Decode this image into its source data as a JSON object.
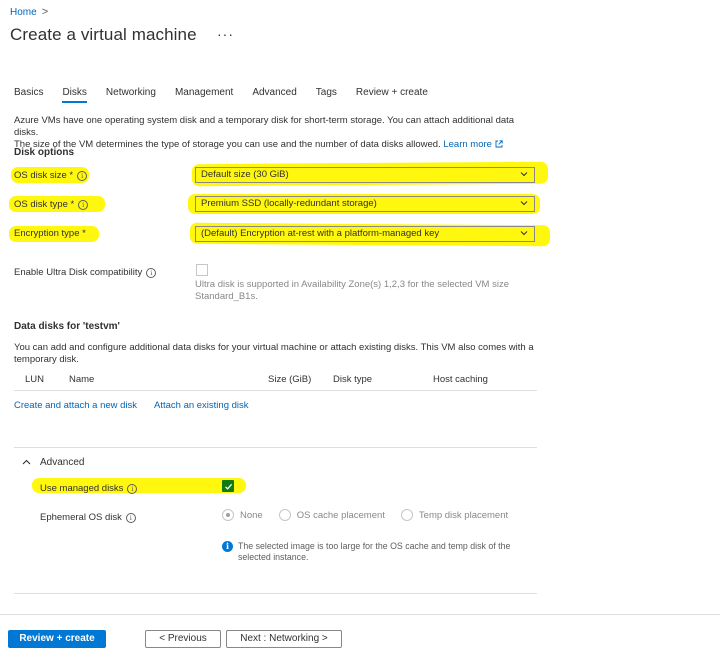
{
  "breadcrumb": {
    "home": "Home",
    "separator": ">"
  },
  "page": {
    "title": "Create a virtual machine",
    "more": "···"
  },
  "tabs": [
    {
      "label": "Basics"
    },
    {
      "label": "Disks"
    },
    {
      "label": "Networking"
    },
    {
      "label": "Management"
    },
    {
      "label": "Advanced"
    },
    {
      "label": "Tags"
    },
    {
      "label": "Review + create"
    }
  ],
  "intro": {
    "line1": "Azure VMs have one operating system disk and a temporary disk for short-term storage. You can attach additional data disks.",
    "line2": "The size of the VM determines the type of storage you can use and the number of data disks allowed.",
    "learn_more": "Learn more"
  },
  "disk_options": {
    "heading": "Disk options",
    "os_disk_size": {
      "label": "OS disk size *",
      "value": "Default size (30 GiB)"
    },
    "os_disk_type": {
      "label": "OS disk type *",
      "value": "Premium SSD (locally-redundant storage)"
    },
    "encryption_type": {
      "label": "Encryption type *",
      "value": "(Default) Encryption at-rest with a platform-managed key"
    },
    "ultra_disk": {
      "label": "Enable Ultra Disk compatibility",
      "note_line1": "Ultra disk is supported in Availability Zone(s) 1,2,3 for the selected VM size",
      "note_line2": "Standard_B1s."
    }
  },
  "data_disks": {
    "heading": "Data disks for 'testvm'",
    "desc_line1": "You can add and configure additional data disks for your virtual machine or attach existing disks. This VM also comes with a",
    "desc_line2": "temporary disk.",
    "columns": [
      "LUN",
      "Name",
      "Size (GiB)",
      "Disk type",
      "Host caching"
    ],
    "create_link": "Create and attach a new disk",
    "attach_link": "Attach an existing disk"
  },
  "advanced": {
    "heading": "Advanced",
    "managed_disks": {
      "label": "Use managed disks",
      "checked": true
    },
    "ephemeral": {
      "label": "Ephemeral OS disk",
      "options": [
        "None",
        "OS cache placement",
        "Temp disk placement"
      ],
      "selected": "None"
    },
    "info_line1": "The selected image is too large for the OS cache and temp disk of the",
    "info_line2": "selected instance."
  },
  "footer": {
    "review_create": "Review + create",
    "previous": "< Previous",
    "next": "Next : Networking >"
  },
  "colors": {
    "accent": "#0078d4",
    "highlight": "#fff700",
    "check": "#107c10"
  }
}
